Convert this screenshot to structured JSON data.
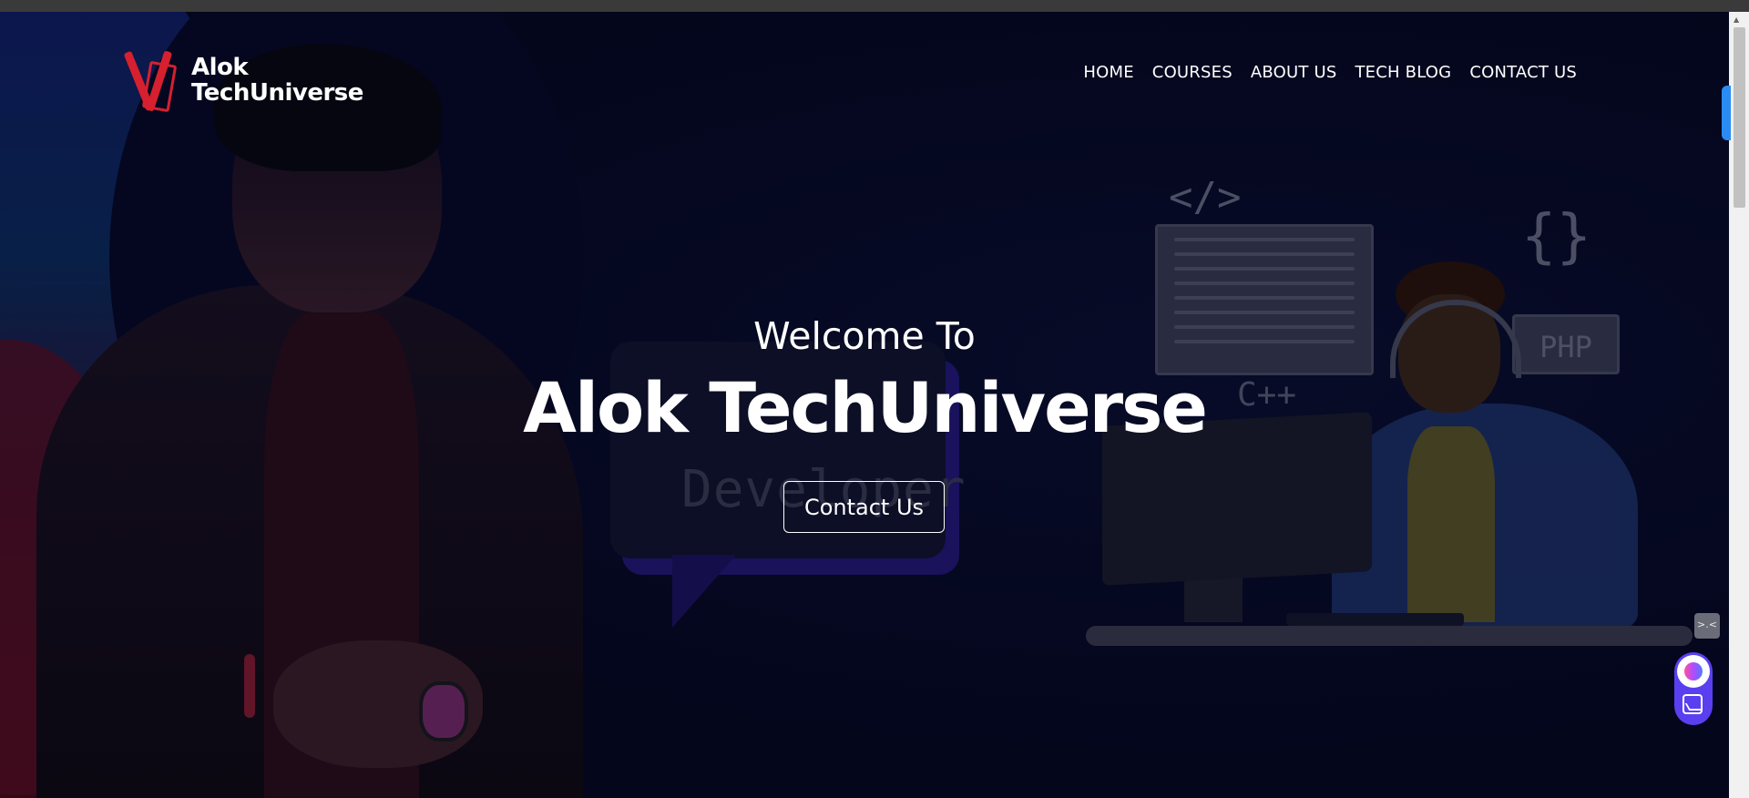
{
  "brand": {
    "name_line1": "Alok",
    "name_line2": "TechUniverse",
    "accent_color": "#d6202f"
  },
  "nav": {
    "items": [
      "HOME",
      "COURSES",
      "ABOUT US",
      "TECH BLOG",
      "CONTACT US"
    ]
  },
  "hero": {
    "welcome": "Welcome To",
    "title": "Alok TechUniverse",
    "cta_label": "Contact Us",
    "background_color": "#050720"
  },
  "illustration": {
    "bubble_text": "Developer",
    "code_symbol": "</>",
    "brace_symbol": "{}",
    "cpp_label": "C++",
    "php_label": "PHP"
  },
  "widgets": {
    "mini_widget_text": ">.<",
    "float_button_color": "#5a3ff0"
  },
  "icons": {
    "logo": "brand-logo-icon",
    "mini_widget": "mini-widget-icon",
    "assistant": "assistant-orb-icon",
    "image": "image-spark-icon"
  }
}
